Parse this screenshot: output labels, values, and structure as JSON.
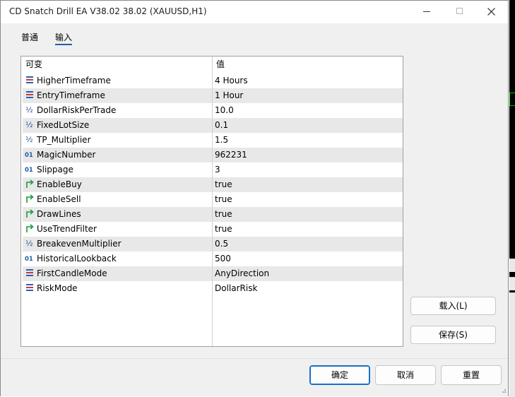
{
  "window": {
    "title": "CD Snatch Drill EA V38.02 38.02 (XAUUSD,H1)"
  },
  "tabs": [
    {
      "label": "普通"
    },
    {
      "label": "输入",
      "active": true
    }
  ],
  "grid": {
    "headers": {
      "variable": "可变",
      "value": "值"
    },
    "rows": [
      {
        "icon": "enum-icon",
        "name": "HigherTimeframe",
        "value": "4 Hours"
      },
      {
        "icon": "enum-icon",
        "name": "EntryTimeframe",
        "value": "1 Hour"
      },
      {
        "icon": "double-icon",
        "name": "DollarRiskPerTrade",
        "value": "10.0"
      },
      {
        "icon": "double-icon",
        "name": "FixedLotSize",
        "value": "0.1"
      },
      {
        "icon": "double-icon",
        "name": "TP_Multiplier",
        "value": "1.5"
      },
      {
        "icon": "integer-icon",
        "name": "MagicNumber",
        "value": "962231"
      },
      {
        "icon": "integer-icon",
        "name": "Slippage",
        "value": "3"
      },
      {
        "icon": "bool-icon",
        "name": "EnableBuy",
        "value": "true"
      },
      {
        "icon": "bool-icon",
        "name": "EnableSell",
        "value": "true"
      },
      {
        "icon": "bool-icon",
        "name": "DrawLines",
        "value": "true"
      },
      {
        "icon": "bool-icon",
        "name": "UseTrendFilter",
        "value": "true"
      },
      {
        "icon": "double-icon",
        "name": "BreakevenMultiplier",
        "value": "0.5"
      },
      {
        "icon": "integer-icon",
        "name": "HistoricalLookback",
        "value": "500"
      },
      {
        "icon": "enum-icon",
        "name": "FirstCandleMode",
        "value": "AnyDirection"
      },
      {
        "icon": "enum-icon",
        "name": "RiskMode",
        "value": "DollarRisk"
      }
    ]
  },
  "buttons": {
    "load": "载入(L)",
    "save": "保存(S)",
    "ok": "确定",
    "cancel": "取消",
    "reset": "重置"
  },
  "colors": {
    "accent": "#1a6fc9",
    "bool_icon": "#1a9a3a",
    "int_icon": "#1f5fa8",
    "enum_icon_blue": "#2b5fb8",
    "enum_icon_red": "#c83a3a"
  }
}
